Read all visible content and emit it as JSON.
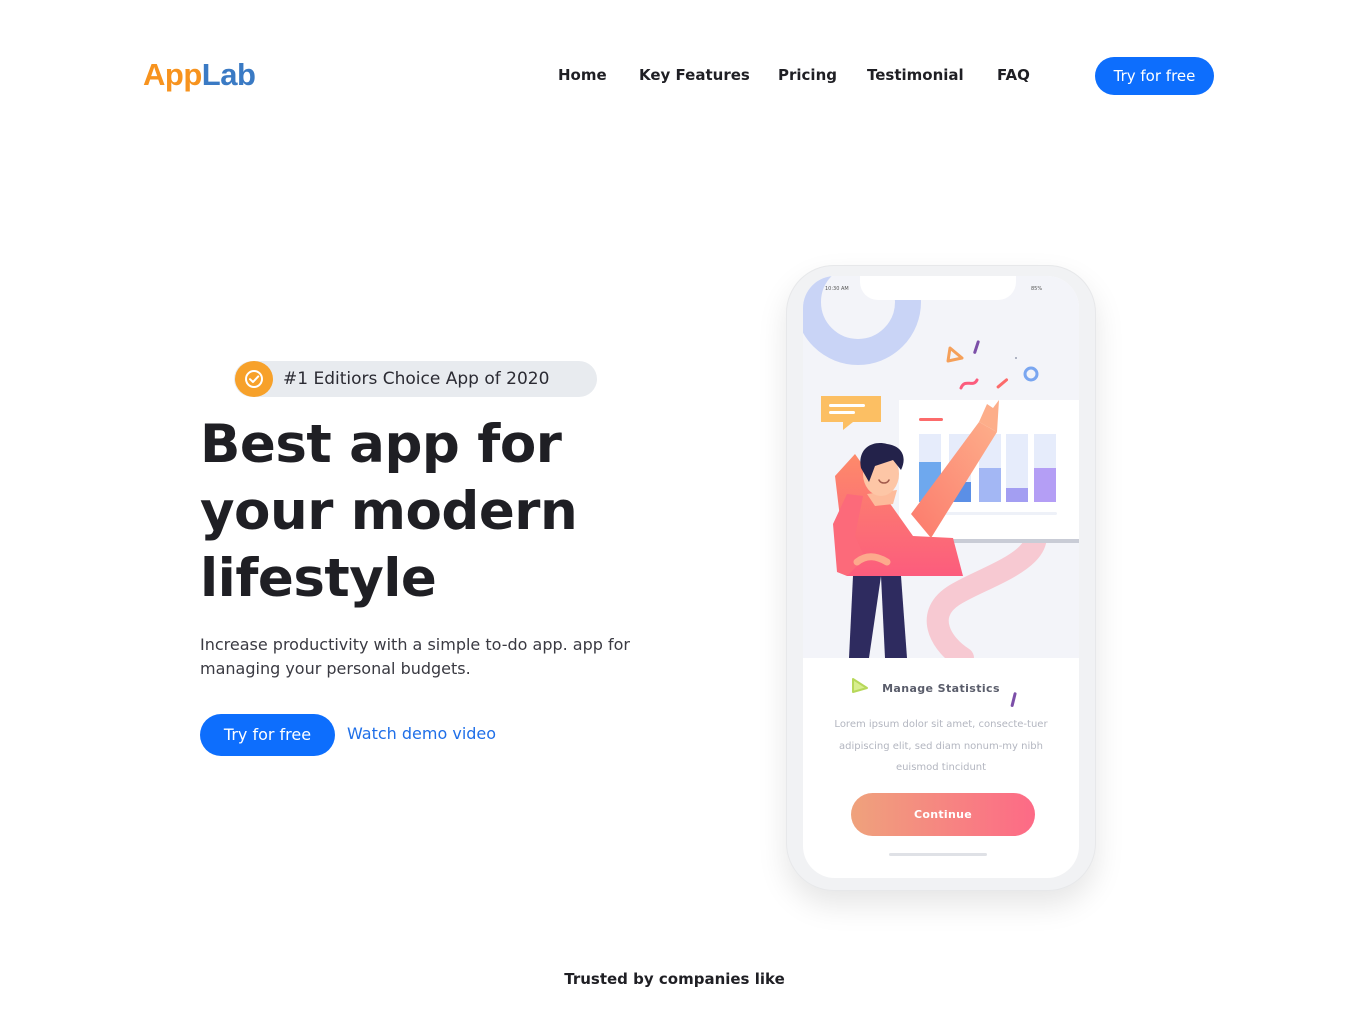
{
  "header": {
    "logo": {
      "part1": "App",
      "part2": "Lab"
    },
    "nav": [
      "Home",
      "Key Features",
      "Pricing",
      "Testimonial",
      "FAQ"
    ],
    "cta_label": "Try for free"
  },
  "hero": {
    "badge_text": "#1 Editiors Choice App of 2020",
    "title_lines": [
      "Best app for",
      "your modern",
      "lifestyle"
    ],
    "description": "Increase productivity with a simple to-do app. app for managing your personal budgets.",
    "primary_label": "Try for free",
    "secondary_label": "Watch demo video"
  },
  "phone": {
    "status_time": "10:30 AM",
    "status_battery": "85%",
    "card_title": "Manage Statistics",
    "card_text": "Lorem ipsum dolor sit amet, consecte-tuer adipiscing elit, sed diam nonum-my nibh euismod tincidunt",
    "card_button": "Continue"
  },
  "trusted_label": "Trusted by companies like",
  "colors": {
    "primary": "#0d6efd",
    "logo_orange": "#f7931e",
    "logo_blue": "#3a7ac4",
    "badge_icon": "#f7a12a",
    "continue_gradient_start": "#efa27c",
    "continue_gradient_end": "#fd6a86"
  },
  "icons": {
    "badge": "verified-check-icon"
  }
}
